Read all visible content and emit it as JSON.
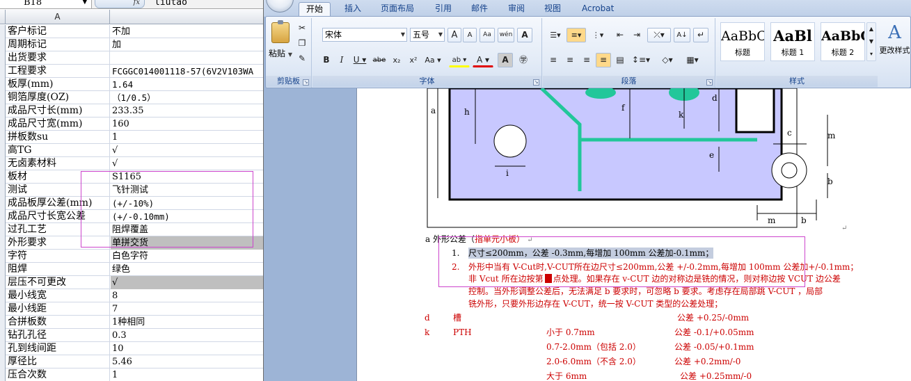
{
  "excel": {
    "name_box": "B18",
    "fx_label": "fx",
    "formula_value": "liutao",
    "column_header": "A",
    "rows": [
      {
        "label": "客户标记",
        "value": "不加"
      },
      {
        "label": "周期标记",
        "value": "加"
      },
      {
        "label": "出货要求",
        "value": ""
      },
      {
        "label": "工程要求",
        "value": "FCGGC014001118-57(6V2V103WA"
      },
      {
        "label": "板厚(mm)",
        "value": "1.64"
      },
      {
        "label": "铜箔厚度(OZ)",
        "value": "（1/0.5）"
      },
      {
        "label": "成品尺寸长(mm)",
        "value": "233.35"
      },
      {
        "label": "成品尺寸宽(mm)",
        "value": "160"
      },
      {
        "label": "拼板数su",
        "value": "1"
      },
      {
        "label": "高TG",
        "value": "√"
      },
      {
        "label": "无卤素材料",
        "value": "√"
      },
      {
        "label": "板材",
        "value": "S1165"
      },
      {
        "label": "测试",
        "value": "飞针测试"
      },
      {
        "label": "成品板厚公差(mm)",
        "value": "(+/-10%)"
      },
      {
        "label": "成品尺寸长宽公差",
        "value": "(+/-0.10mm)"
      },
      {
        "label": "过孔工艺",
        "value": "阻焊覆盖"
      },
      {
        "label": "外形要求",
        "value": "单拼交货"
      },
      {
        "label": "字符",
        "value": "白色字符"
      },
      {
        "label": "阻焊",
        "value": "绿色"
      },
      {
        "label": "层压不可更改",
        "value": "√"
      },
      {
        "label": "最小线宽",
        "value": "8"
      },
      {
        "label": "最小线距",
        "value": "7"
      },
      {
        "label": "合拼板数",
        "value": "1种相同"
      },
      {
        "label": "钻孔孔径",
        "value": "0.3"
      },
      {
        "label": "孔到线间距",
        "value": "10"
      },
      {
        "label": "厚径比",
        "value": "5.46"
      },
      {
        "label": "压合次数",
        "value": "1"
      }
    ]
  },
  "word": {
    "tabs": [
      "开始",
      "插入",
      "页面布局",
      "引用",
      "邮件",
      "审阅",
      "视图",
      "Acrobat"
    ],
    "active_tab": "开始",
    "clipboard": {
      "paste": "粘贴",
      "group": "剪贴板"
    },
    "font": {
      "name": "宋体",
      "size": "五号",
      "group": "字体"
    },
    "paragraph": {
      "group": "段落"
    },
    "styles": {
      "group": "样式",
      "items": [
        {
          "sample": "AaBbC",
          "name": "标题"
        },
        {
          "sample": "AaBl",
          "name": "标题 1"
        },
        {
          "sample": "AaBbC",
          "name": "标题 2"
        }
      ],
      "change_label": "更改样式"
    },
    "document": {
      "dims": {
        "a": "a",
        "h": "h",
        "f": "f",
        "k": "k",
        "d": "d",
        "i": "i",
        "e": "e",
        "c": "c",
        "m_right": "m",
        "b_right": "b",
        "m_bottom": "m",
        "b_bottom": "b"
      },
      "heading_prefix": "a 外形公差（",
      "heading_note": "指单元小板",
      "heading_suffix": "）",
      "item1_num": "1.",
      "item1": "尺寸≤200mm，公差 -0.3mm,每增加 100mm 公差加-0.1mm；",
      "item2_num": "2.",
      "item2_line1": "外形中当有 V-Cut时,V-CUT所在边尺寸≤200mm,公差 +/-0.2mm,每增加 100mm 公差加+/-0.1mm；",
      "item2_line2a": "非 Vcut 所在边按第",
      "item2_line2b": "点处理。如果存在 v-CUT 边的对称边是铣的情况，则对称边按 VCUT 边公差",
      "item2_line3": "控制。当外形调整公差后，无法满足 b 要求时，可忽略 b 要求。考虑存在局部跳 V-CUT ，局部",
      "item2_line4": "铣外形，只要外形边存在 V-CUT，统一按 V-CUT 类型的公差处理；",
      "slot_code": "d",
      "slot_name": "槽",
      "slot_tol": "公差 +0.25/-0mm",
      "k_code": "k",
      "k_name": "PTH",
      "k_rows": [
        {
          "range": "小于 0.7mm",
          "tol": "公差 -0.1/+0.05mm"
        },
        {
          "range": "0.7-2.0mm（包括 2.0）",
          "tol": "公差  -0.05/+0.1mm"
        },
        {
          "range": "2.0-6.0mm（不含 2.0）",
          "tol": "公差 +0.2mm/-0"
        },
        {
          "range": "大于 6mm",
          "tol": "公差 +0.25mm/-0"
        }
      ]
    }
  },
  "colors": {
    "figure_fill": "#c8c8ff",
    "trace": "#22c79a",
    "pad": "#22c79a",
    "highlight_box": "#cc44cc",
    "text_red": "#cc0000"
  }
}
